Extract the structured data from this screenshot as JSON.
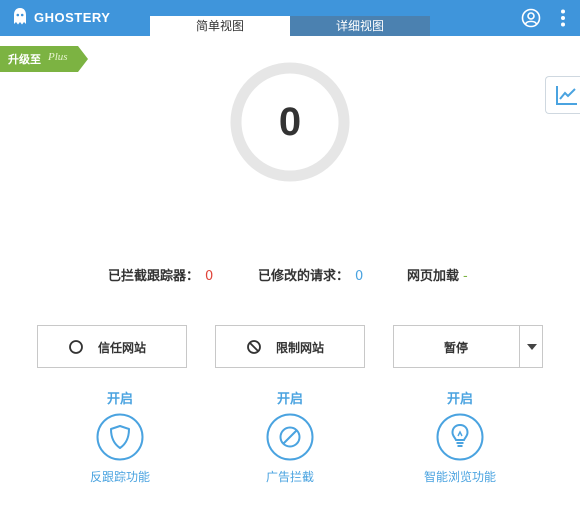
{
  "header": {
    "brand": "GHOSTERY",
    "tabs": [
      {
        "label": "简单视图",
        "active": true
      },
      {
        "label": "详细视图",
        "active": false
      }
    ],
    "icons": [
      "user-icon",
      "menu-icon"
    ]
  },
  "upgrade": {
    "label": "升级至",
    "plus": "Plus"
  },
  "tracker_count": "0",
  "stats": {
    "blocked_label": "已拦截跟踪器：",
    "blocked_value": "0",
    "modified_label": "已修改的请求：",
    "modified_value": "0",
    "load_label": "网页加载",
    "load_value": "-"
  },
  "buttons": {
    "trust": "信任网站",
    "restrict": "限制网站",
    "pause": "暂停"
  },
  "features": [
    {
      "status": "开启",
      "name": "反跟踪功能",
      "icon": "shield-icon"
    },
    {
      "status": "开启",
      "name": "广告拦截",
      "icon": "ad-block-icon"
    },
    {
      "status": "开启",
      "name": "智能浏览功能",
      "icon": "lightbulb-icon"
    }
  ],
  "colors": {
    "header": "#3f95db",
    "accent": "#4aa3e0",
    "plus_green": "#7cb342",
    "blocked_red": "#e0443a"
  }
}
